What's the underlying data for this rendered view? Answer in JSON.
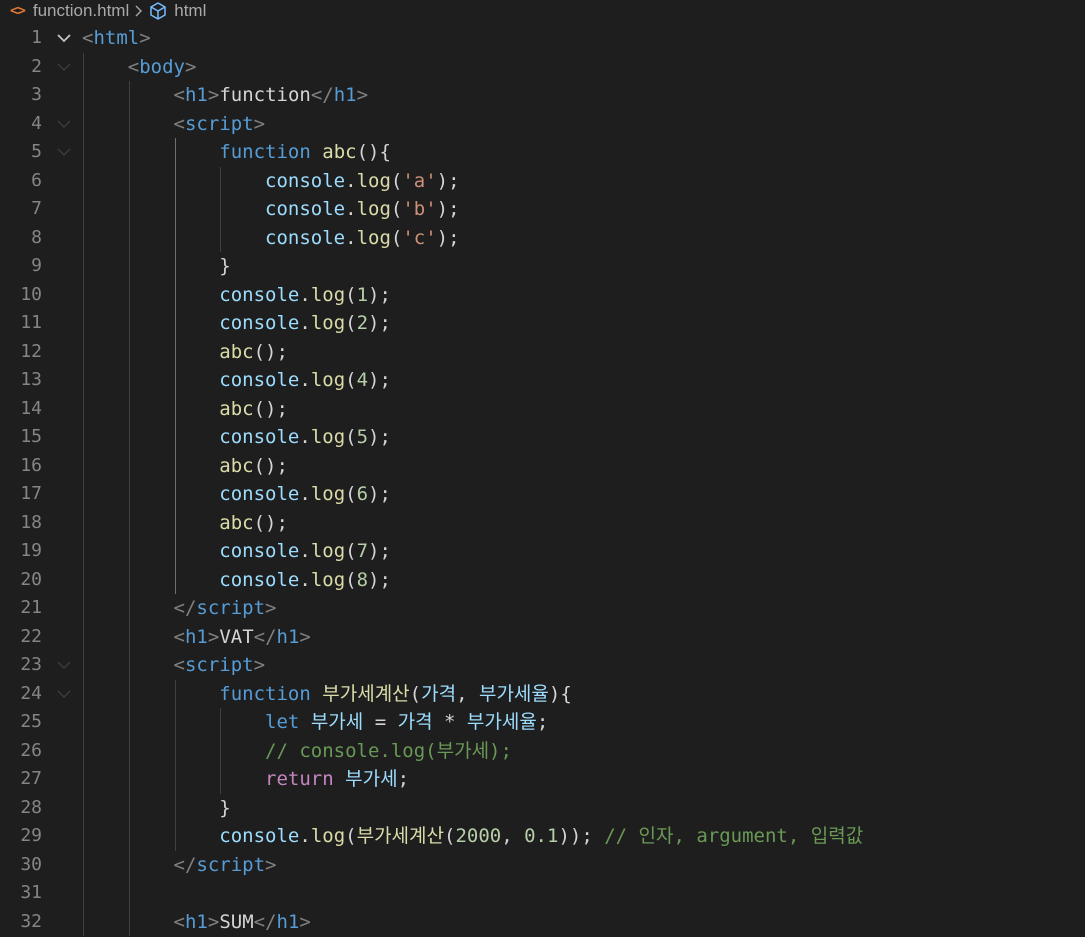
{
  "breadcrumb": {
    "file_icon": "<>",
    "file": "function.html",
    "separator_icon": "chevron-right-icon",
    "symbol_icon": "cube-icon",
    "symbol": "html"
  },
  "line_numbers": [
    "1",
    "2",
    "3",
    "4",
    "5",
    "6",
    "7",
    "8",
    "9",
    "10",
    "11",
    "12",
    "13",
    "14",
    "15",
    "16",
    "17",
    "18",
    "19",
    "20",
    "21",
    "22",
    "23",
    "24",
    "25",
    "26",
    "27",
    "28",
    "29",
    "30",
    "31",
    "32"
  ],
  "code": {
    "l1": [
      [
        "<",
        "tag"
      ],
      [
        "html",
        "name"
      ],
      [
        ">",
        "tag"
      ]
    ],
    "l2": [
      [
        "    ",
        ""
      ],
      [
        "<",
        "tag"
      ],
      [
        "body",
        "name"
      ],
      [
        ">",
        "tag"
      ]
    ],
    "l3": [
      [
        "        ",
        ""
      ],
      [
        "<",
        "tag"
      ],
      [
        "h1",
        "name"
      ],
      [
        ">",
        "tag"
      ],
      [
        "function",
        "txt"
      ],
      [
        "</",
        "tag"
      ],
      [
        "h1",
        "name"
      ],
      [
        ">",
        "tag"
      ]
    ],
    "l4": [
      [
        "        ",
        ""
      ],
      [
        "<",
        "tag"
      ],
      [
        "script",
        "name"
      ],
      [
        ">",
        "tag"
      ]
    ],
    "l5": [
      [
        "            ",
        ""
      ],
      [
        "function",
        "kw"
      ],
      [
        " ",
        ""
      ],
      [
        "abc",
        "fn"
      ],
      [
        "(){",
        "punc"
      ]
    ],
    "l6": [
      [
        "                ",
        ""
      ],
      [
        "console",
        "var"
      ],
      [
        ".",
        "punc"
      ],
      [
        "log",
        "fn"
      ],
      [
        "(",
        "punc"
      ],
      [
        "'a'",
        "str"
      ],
      [
        ");",
        "punc"
      ]
    ],
    "l7": [
      [
        "                ",
        ""
      ],
      [
        "console",
        "var"
      ],
      [
        ".",
        "punc"
      ],
      [
        "log",
        "fn"
      ],
      [
        "(",
        "punc"
      ],
      [
        "'b'",
        "str"
      ],
      [
        ");",
        "punc"
      ]
    ],
    "l8": [
      [
        "                ",
        ""
      ],
      [
        "console",
        "var"
      ],
      [
        ".",
        "punc"
      ],
      [
        "log",
        "fn"
      ],
      [
        "(",
        "punc"
      ],
      [
        "'c'",
        "str"
      ],
      [
        ");",
        "punc"
      ]
    ],
    "l9": [
      [
        "            ",
        ""
      ],
      [
        "}",
        "punc"
      ]
    ],
    "l10": [
      [
        "            ",
        ""
      ],
      [
        "console",
        "var"
      ],
      [
        ".",
        "punc"
      ],
      [
        "log",
        "fn"
      ],
      [
        "(",
        "punc"
      ],
      [
        "1",
        "num"
      ],
      [
        ");",
        "punc"
      ]
    ],
    "l11": [
      [
        "            ",
        ""
      ],
      [
        "console",
        "var"
      ],
      [
        ".",
        "punc"
      ],
      [
        "log",
        "fn"
      ],
      [
        "(",
        "punc"
      ],
      [
        "2",
        "num"
      ],
      [
        ");",
        "punc"
      ]
    ],
    "l12": [
      [
        "            ",
        ""
      ],
      [
        "abc",
        "fn"
      ],
      [
        "();",
        "punc"
      ]
    ],
    "l13": [
      [
        "            ",
        ""
      ],
      [
        "console",
        "var"
      ],
      [
        ".",
        "punc"
      ],
      [
        "log",
        "fn"
      ],
      [
        "(",
        "punc"
      ],
      [
        "4",
        "num"
      ],
      [
        ");",
        "punc"
      ]
    ],
    "l14": [
      [
        "            ",
        ""
      ],
      [
        "abc",
        "fn"
      ],
      [
        "();",
        "punc"
      ]
    ],
    "l15": [
      [
        "            ",
        ""
      ],
      [
        "console",
        "var"
      ],
      [
        ".",
        "punc"
      ],
      [
        "log",
        "fn"
      ],
      [
        "(",
        "punc"
      ],
      [
        "5",
        "num"
      ],
      [
        ");",
        "punc"
      ]
    ],
    "l16": [
      [
        "            ",
        ""
      ],
      [
        "abc",
        "fn"
      ],
      [
        "();",
        "punc"
      ]
    ],
    "l17": [
      [
        "            ",
        ""
      ],
      [
        "console",
        "var"
      ],
      [
        ".",
        "punc"
      ],
      [
        "log",
        "fn"
      ],
      [
        "(",
        "punc"
      ],
      [
        "6",
        "num"
      ],
      [
        ");",
        "punc"
      ]
    ],
    "l18": [
      [
        "            ",
        ""
      ],
      [
        "abc",
        "fn"
      ],
      [
        "();",
        "punc"
      ]
    ],
    "l19": [
      [
        "            ",
        ""
      ],
      [
        "console",
        "var"
      ],
      [
        ".",
        "punc"
      ],
      [
        "log",
        "fn"
      ],
      [
        "(",
        "punc"
      ],
      [
        "7",
        "num"
      ],
      [
        ");",
        "punc"
      ]
    ],
    "l20": [
      [
        "            ",
        ""
      ],
      [
        "console",
        "var"
      ],
      [
        ".",
        "punc"
      ],
      [
        "log",
        "fn"
      ],
      [
        "(",
        "punc"
      ],
      [
        "8",
        "num"
      ],
      [
        ");",
        "punc"
      ]
    ],
    "l21": [
      [
        "        ",
        ""
      ],
      [
        "</",
        "tag"
      ],
      [
        "script",
        "name"
      ],
      [
        ">",
        "tag"
      ]
    ],
    "l22": [
      [
        "        ",
        ""
      ],
      [
        "<",
        "tag"
      ],
      [
        "h1",
        "name"
      ],
      [
        ">",
        "tag"
      ],
      [
        "VAT",
        "txt"
      ],
      [
        "</",
        "tag"
      ],
      [
        "h1",
        "name"
      ],
      [
        ">",
        "tag"
      ]
    ],
    "l23": [
      [
        "        ",
        ""
      ],
      [
        "<",
        "tag"
      ],
      [
        "script",
        "name"
      ],
      [
        ">",
        "tag"
      ]
    ],
    "l24": [
      [
        "            ",
        ""
      ],
      [
        "function",
        "kw"
      ],
      [
        " ",
        ""
      ],
      [
        "부가세계산",
        "fn"
      ],
      [
        "(",
        "punc"
      ],
      [
        "가격",
        "var"
      ],
      [
        ", ",
        "punc"
      ],
      [
        "부가세율",
        "var"
      ],
      [
        "){",
        "punc"
      ]
    ],
    "l25": [
      [
        "                ",
        ""
      ],
      [
        "let",
        "kw"
      ],
      [
        " ",
        ""
      ],
      [
        "부가세",
        "var"
      ],
      [
        " = ",
        "punc"
      ],
      [
        "가격",
        "var"
      ],
      [
        " * ",
        "punc"
      ],
      [
        "부가세율",
        "var"
      ],
      [
        ";",
        "punc"
      ]
    ],
    "l26": [
      [
        "                ",
        ""
      ],
      [
        "// console.log(부가세);",
        "cmt"
      ]
    ],
    "l27": [
      [
        "                ",
        ""
      ],
      [
        "return",
        "ctrl"
      ],
      [
        " ",
        ""
      ],
      [
        "부가세",
        "var"
      ],
      [
        ";",
        "punc"
      ]
    ],
    "l28": [
      [
        "            ",
        ""
      ],
      [
        "}",
        "punc"
      ]
    ],
    "l29": [
      [
        "            ",
        ""
      ],
      [
        "console",
        "var"
      ],
      [
        ".",
        "punc"
      ],
      [
        "log",
        "fn"
      ],
      [
        "(",
        "punc"
      ],
      [
        "부가세계산",
        "fn"
      ],
      [
        "(",
        "punc"
      ],
      [
        "2000",
        "num"
      ],
      [
        ", ",
        "punc"
      ],
      [
        "0.1",
        "num"
      ],
      [
        ")); ",
        "punc"
      ],
      [
        "// 인자, argument, 입력값",
        "cmt"
      ]
    ],
    "l30": [
      [
        "        ",
        ""
      ],
      [
        "</",
        "tag"
      ],
      [
        "script",
        "name"
      ],
      [
        ">",
        "tag"
      ]
    ],
    "l31": [],
    "l32": [
      [
        "        ",
        ""
      ],
      [
        "<",
        "tag"
      ],
      [
        "h1",
        "name"
      ],
      [
        ">",
        "tag"
      ],
      [
        "SUM",
        "txt"
      ],
      [
        "</",
        "tag"
      ],
      [
        "h1",
        "name"
      ],
      [
        ">",
        "tag"
      ]
    ]
  },
  "folded_lines": [
    1,
    2,
    4,
    5,
    23,
    24
  ],
  "expanded_fold_line": 1,
  "colors": {
    "background": "#1e1e1e",
    "line_number": "#858585",
    "tag_bracket": "#808080",
    "tag_name": "#569cd6",
    "keyword": "#569cd6",
    "function": "#dcdcaa",
    "variable": "#9cdcfe",
    "string": "#ce9178",
    "number": "#b5cea8",
    "comment": "#6a9955",
    "control": "#c586c0",
    "html_icon": "#e37933"
  }
}
